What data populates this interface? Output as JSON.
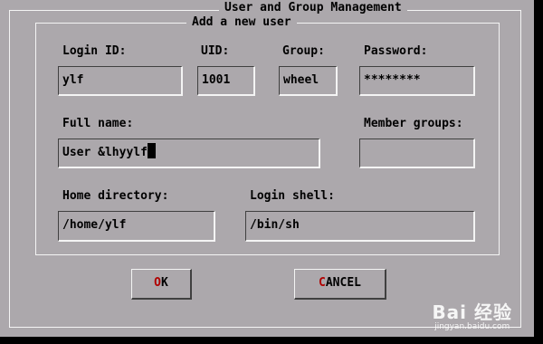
{
  "window": {
    "title": "User and Group Management"
  },
  "section": {
    "title": "Add a new user"
  },
  "fields": {
    "login_id": {
      "label": "Login ID:",
      "value": "ylf"
    },
    "uid": {
      "label": "UID:",
      "value": "1001"
    },
    "group": {
      "label": "Group:",
      "value": "wheel"
    },
    "password": {
      "label": "Password:",
      "value": "********"
    },
    "full_name": {
      "label": "Full name:",
      "value": "User &lhyylf"
    },
    "member_groups": {
      "label": "Member groups:",
      "value": ""
    },
    "home_directory": {
      "label": "Home directory:",
      "value": "/home/ylf"
    },
    "login_shell": {
      "label": "Login shell:",
      "value": "/bin/sh"
    }
  },
  "buttons": {
    "ok": {
      "hotkey": "O",
      "rest": "K"
    },
    "cancel": {
      "hotkey": "C",
      "rest": "ANCEL"
    }
  },
  "colors": {
    "background": "#aca8ac",
    "highlight": "#f4f4f4",
    "shadow": "#404040",
    "hotkey": "#b00000"
  },
  "watermark": {
    "logo": "Bai 经验",
    "url": "jingyan.baidu.com"
  }
}
